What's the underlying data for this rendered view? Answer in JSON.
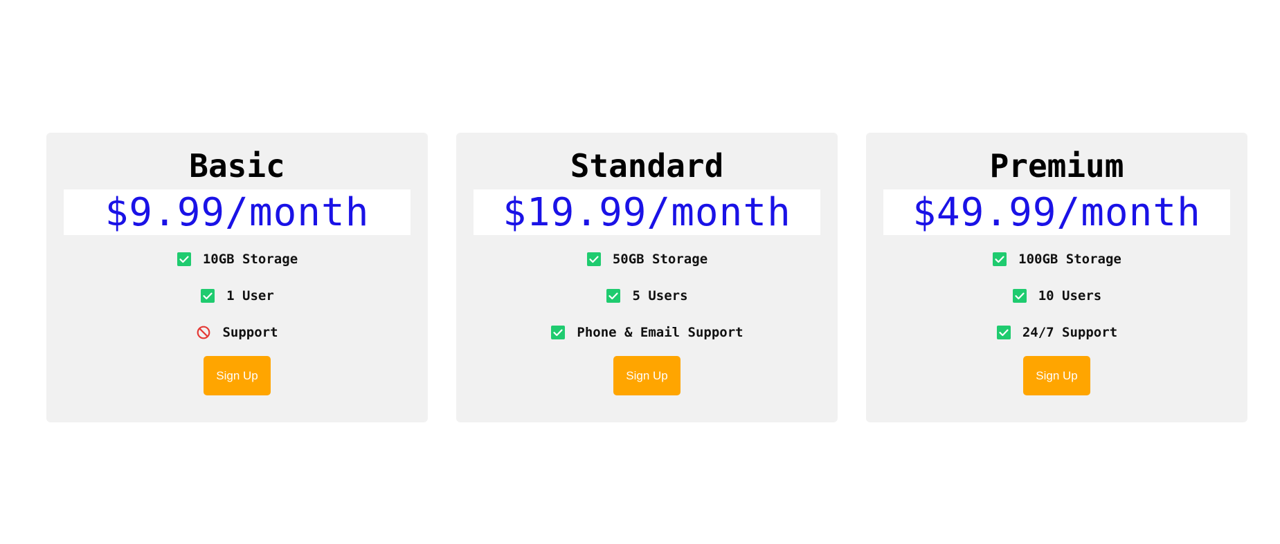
{
  "colors": {
    "card_background": "#f1f1f1",
    "price_color": "#1a12e6",
    "check_color": "#1fcb6f",
    "not_included_color": "#e53935",
    "button_color": "#ffa500"
  },
  "plans": [
    {
      "name": "Basic",
      "price": "$9.99/month",
      "features": [
        {
          "text": "10GB Storage",
          "icon": "check-icon",
          "included": true
        },
        {
          "text": "1 User",
          "icon": "check-icon",
          "included": true
        },
        {
          "text": "Support",
          "icon": "prohibited-icon",
          "included": false
        }
      ],
      "button_label": "Sign Up"
    },
    {
      "name": "Standard",
      "price": "$19.99/month",
      "features": [
        {
          "text": "50GB Storage",
          "icon": "check-icon",
          "included": true
        },
        {
          "text": "5 Users",
          "icon": "check-icon",
          "included": true
        },
        {
          "text": "Phone & Email Support",
          "icon": "check-icon",
          "included": true
        }
      ],
      "button_label": "Sign Up"
    },
    {
      "name": "Premium",
      "price": "$49.99/month",
      "features": [
        {
          "text": "100GB Storage",
          "icon": "check-icon",
          "included": true
        },
        {
          "text": "10 Users",
          "icon": "check-icon",
          "included": true
        },
        {
          "text": "24/7 Support",
          "icon": "check-icon",
          "included": true
        }
      ],
      "button_label": "Sign Up"
    }
  ]
}
